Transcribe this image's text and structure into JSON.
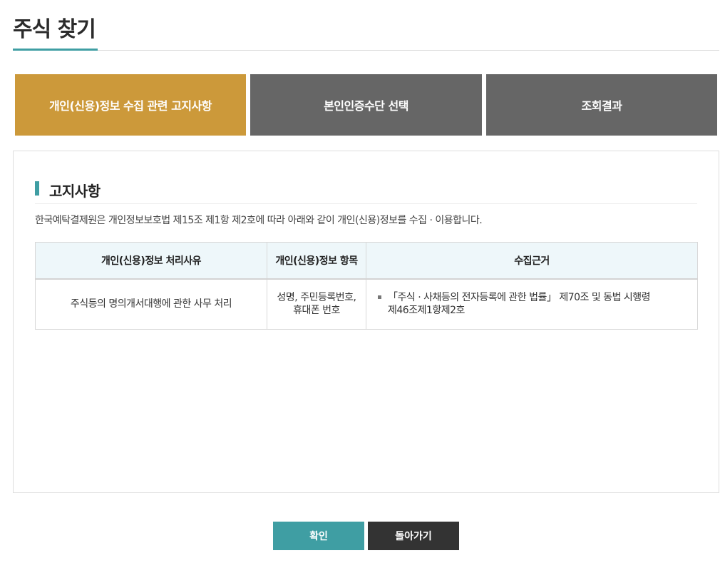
{
  "page": {
    "title": "주식 찾기"
  },
  "steps": [
    {
      "label": "개인(신용)정보 수집 관련 고지사항",
      "active": true
    },
    {
      "label": "본인인증수단 선택",
      "active": false
    },
    {
      "label": "조회결과",
      "active": false
    }
  ],
  "notice": {
    "section_title": "고지사항",
    "description": "한국예탁결제원은 개인정보보호법 제15조 제1항 제2호에 따라 아래와 같이 개인(신용)정보를 수집 · 이용합니다.",
    "table": {
      "headers": [
        "개인(신용)정보 처리사유",
        "개인(신용)정보 항목",
        "수집근거"
      ],
      "row": {
        "purpose": "주식등의 명의개서대행에 관한 사무 처리",
        "items_line1": "성명, 주민등록번호,",
        "items_line2": "휴대폰 번호",
        "basis_line1": "「주식 · 사채등의 전자등록에 관한 법률」 제70조 및 동법 시행령",
        "basis_line2": "제46조제1항제2호"
      }
    }
  },
  "buttons": {
    "confirm": "확인",
    "back": "돌아가기"
  },
  "colors": {
    "accent": "#3f9ea3",
    "active_step": "#cc993a",
    "inactive_step": "#666666",
    "dark_button": "#333333"
  }
}
